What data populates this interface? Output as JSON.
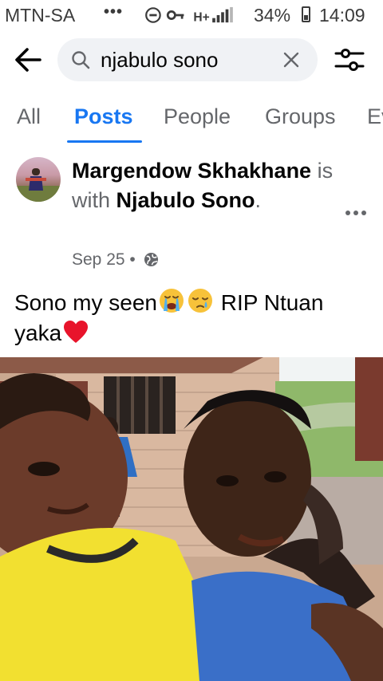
{
  "status_bar": {
    "carrier": "MTN-SA",
    "dots": "•••",
    "network_label": "H+",
    "battery": "34%",
    "time": "14:09"
  },
  "search": {
    "query": "njabulo sono"
  },
  "tabs": [
    {
      "label": "All",
      "active": false
    },
    {
      "label": "Posts",
      "active": true
    },
    {
      "label": "People",
      "active": false
    },
    {
      "label": "Groups",
      "active": false
    },
    {
      "label": "Ev",
      "active": false
    }
  ],
  "post": {
    "author": "Margendow Skhakhane",
    "with_text": "is with",
    "tagged": "Njabulo Sono",
    "tagged_suffix": ".",
    "date": "Sep 25",
    "separator": "•",
    "text_part1": "Sono my seen",
    "text_part2": " RIP Ntuan yaka",
    "emojis": [
      "loudly-crying-face",
      "sleepy-face",
      "red-heart"
    ]
  },
  "colors": {
    "accent": "#1877f2",
    "secondary_text": "#65676b",
    "search_bg": "#f0f2f5"
  }
}
